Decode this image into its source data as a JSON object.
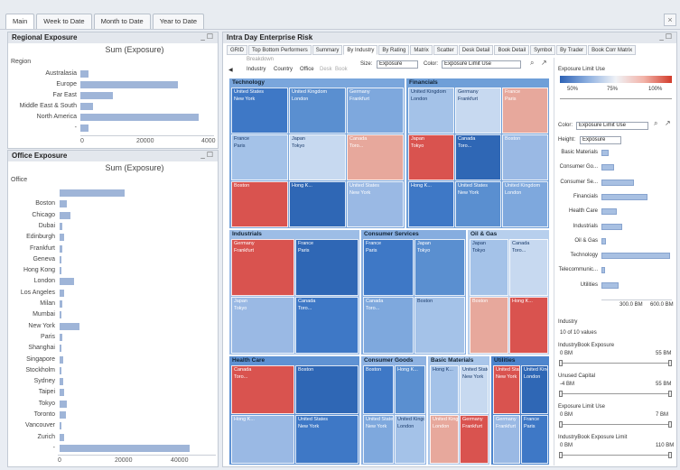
{
  "top_tabs": [
    "Main",
    "Week to Date",
    "Month to Date",
    "Year to Date"
  ],
  "regional": {
    "title": "Regional Exposure",
    "chart_title": "Sum (Exposure)",
    "axis_label": "Region",
    "ticks": [
      "0",
      "20000",
      "4000"
    ],
    "rows": [
      {
        "label": "Australasia",
        "value": 0.04
      },
      {
        "label": "Europe",
        "value": 0.48
      },
      {
        "label": "Far East",
        "value": 0.16
      },
      {
        "label": "Middle East & South",
        "value": 0.06
      },
      {
        "label": "North America",
        "value": 0.58
      },
      {
        "label": "-",
        "value": 0.04
      }
    ]
  },
  "office": {
    "title": "Office Exposure",
    "chart_title": "Sum (Exposure)",
    "axis_label": "Office",
    "ticks": [
      "0",
      "20000",
      "40000"
    ],
    "rows": [
      {
        "label": "",
        "value": 0.36
      },
      {
        "label": "Boston",
        "value": 0.04
      },
      {
        "label": "Chicago",
        "value": 0.06
      },
      {
        "label": "Dubai",
        "value": 0.015
      },
      {
        "label": "Edinburgh",
        "value": 0.025
      },
      {
        "label": "Frankfurt",
        "value": 0.015
      },
      {
        "label": "Geneva",
        "value": 0.01
      },
      {
        "label": "Hong Kong",
        "value": 0.01
      },
      {
        "label": "London",
        "value": 0.08
      },
      {
        "label": "Los Angeles",
        "value": 0.025
      },
      {
        "label": "Milan",
        "value": 0.015
      },
      {
        "label": "Mumbai",
        "value": 0.01
      },
      {
        "label": "New York",
        "value": 0.11
      },
      {
        "label": "Paris",
        "value": 0.015
      },
      {
        "label": "Shanghai",
        "value": 0.005
      },
      {
        "label": "Singapore",
        "value": 0.02
      },
      {
        "label": "Stockholm",
        "value": 0.01
      },
      {
        "label": "Sydney",
        "value": 0.02
      },
      {
        "label": "Taipei",
        "value": 0.025
      },
      {
        "label": "Tokyo",
        "value": 0.04
      },
      {
        "label": "Toronto",
        "value": 0.035
      },
      {
        "label": "Vancouver",
        "value": 0.01
      },
      {
        "label": "Zurich",
        "value": 0.025
      },
      {
        "label": "-",
        "value": 0.72
      }
    ]
  },
  "risk": {
    "title": "Intra Day Enterprise Risk",
    "tabs": [
      "GRID",
      "Top Bottom Performers",
      "Summary",
      "By Industry",
      "By Rating",
      "Matrix",
      "Scatter",
      "Desk Detail",
      "Book Detail",
      "Symbol",
      "By Trader",
      "Book Corr Matrix"
    ],
    "breakdown_label": "Breakdown",
    "breakdown_items": [
      "Industry",
      "Country",
      "Office",
      "Desk",
      "Book"
    ],
    "size_label": "Size:",
    "size_value": "Exposure",
    "color_label": "Color:",
    "color_value": "Exposure Limit Use",
    "sections": [
      "Technology",
      "Financials",
      "Industrials",
      "Consumer Services",
      "Oil & Gas",
      "Health Care",
      "Consumer Goods",
      "Basic Materials",
      "Utilities"
    ],
    "cells": [
      {
        "t": "United States",
        "sub": "New York"
      },
      {
        "t": "United Kingdom",
        "sub": "London"
      },
      {
        "t": "Germany",
        "sub": "Frankfurt"
      },
      {
        "t": "France",
        "sub": "Paris"
      },
      {
        "t": "Japan",
        "sub": "Tokyo"
      },
      {
        "t": "Canada",
        "sub": "Toro..."
      },
      {
        "t": "Boston",
        "sub": ""
      },
      {
        "t": "Hong K...",
        "sub": ""
      }
    ]
  },
  "right": {
    "legend_title": "Exposure Limit Use",
    "legend_ticks": [
      "50%",
      "75%",
      "100%"
    ],
    "color_label": "Color:",
    "color_value": "Exposure Limit Use",
    "height_label": "Height:",
    "height_value": "Exposure",
    "industries": [
      {
        "label": "Basic Materials",
        "value": 0.1
      },
      {
        "label": "Consumer Go...",
        "value": 0.18
      },
      {
        "label": "Consumer Se...",
        "value": 0.46
      },
      {
        "label": "Financials",
        "value": 0.66
      },
      {
        "label": "Health Care",
        "value": 0.22
      },
      {
        "label": "Industrials",
        "value": 0.3
      },
      {
        "label": "Oil & Gas",
        "value": 0.06
      },
      {
        "label": "Technology",
        "value": 0.98
      },
      {
        "label": "Telecommunic...",
        "value": 0.05
      },
      {
        "label": "Utilities",
        "value": 0.24
      }
    ],
    "axis_ticks": [
      "300.0 BM",
      "600.0 BM"
    ],
    "filter_industry_label": "Industry",
    "filter_industry_value": "10 of 10 values",
    "filters": [
      {
        "label": "IndustryBook Exposure",
        "min": "0 BM",
        "max": "55 BM"
      },
      {
        "label": "Unused Capital",
        "min": "-4 BM",
        "max": "55 BM"
      },
      {
        "label": "Exposure Limit Use",
        "min": "0 BM",
        "max": "7 BM"
      },
      {
        "label": "IndustryBook Exposure Limit",
        "min": "0 BM",
        "max": "110 BM"
      }
    ]
  }
}
